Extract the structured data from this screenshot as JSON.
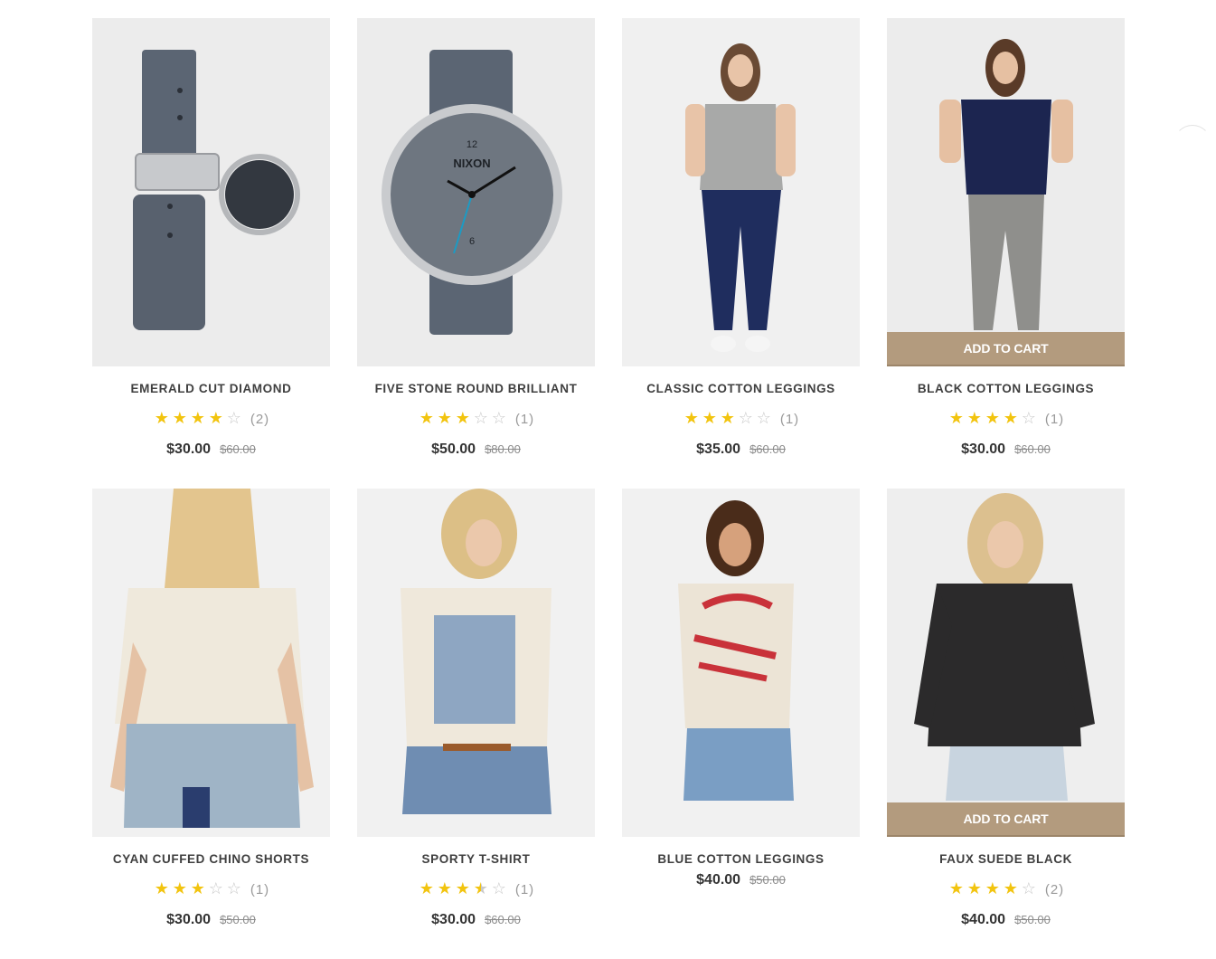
{
  "product_grid": {
    "add_to_cart_label": "ADD TO CART",
    "products": [
      {
        "title": "EMERALD CUT DIAMOND",
        "rating": 4,
        "reviews": "(2)",
        "price": "$30.00",
        "old_price": "$60.00",
        "image": "watch-back-icon"
      },
      {
        "title": "FIVE STONE ROUND BRILLIANT",
        "rating": 3,
        "reviews": "(1)",
        "price": "$50.00",
        "old_price": "$80.00",
        "image": "watch-front-icon"
      },
      {
        "title": "CLASSIC COTTON LEGGINGS",
        "rating": 3,
        "reviews": "(1)",
        "price": "$35.00",
        "old_price": "$60.00",
        "image": "model-grey-tee-icon"
      },
      {
        "title": "BLACK COTTON LEGGINGS",
        "rating": 4,
        "reviews": "(1)",
        "price": "$30.00",
        "old_price": "$60.00",
        "image": "model-navy-tee-icon"
      },
      {
        "title": "CYAN CUFFED CHINO SHORTS",
        "rating": 3,
        "reviews": "(1)",
        "price": "$30.00",
        "old_price": "$50.00",
        "image": "model-back-tee-icon"
      },
      {
        "title": "SPORTY T-SHIRT",
        "rating": 3.5,
        "reviews": "(1)",
        "price": "$30.00",
        "old_price": "$60.00",
        "image": "model-print-tee-icon"
      },
      {
        "title": "BLUE COTTON LEGGINGS",
        "rating": null,
        "reviews": "",
        "price": "$40.00",
        "old_price": "$50.00",
        "image": "model-greenwich-tee-icon"
      },
      {
        "title": "FAUX SUEDE BLACK",
        "rating": 4,
        "reviews": "(2)",
        "price": "$40.00",
        "old_price": "$50.00",
        "image": "model-black-top-icon"
      }
    ]
  },
  "colors": {
    "star": "#f2c40f",
    "cart_button": "#b39b7e",
    "image_bg": "#efefef"
  }
}
